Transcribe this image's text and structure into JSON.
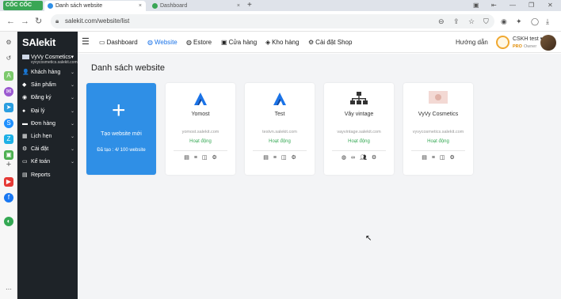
{
  "browser": {
    "brand": "CỐC CỐC",
    "tabs": [
      {
        "label": "Danh sách website",
        "close": "×"
      },
      {
        "label": "Dashboard",
        "close": "×"
      }
    ],
    "new_tab": "+",
    "url": "salekit.com/website/list"
  },
  "app": {
    "logo": "SAlekit",
    "store_name": "VyVy Cosmetics",
    "store_domain": "vyvycosmetics.salekit.com",
    "menu": [
      {
        "label": "Khách hàng",
        "icon": "user-icon",
        "glyph": "👤",
        "has_children": true
      },
      {
        "label": "Sản phẩm",
        "icon": "tag-icon",
        "glyph": "◆",
        "has_children": true
      },
      {
        "label": "Đăng ký",
        "icon": "eye-icon",
        "glyph": "◉",
        "has_children": true
      },
      {
        "label": "Đại lý",
        "icon": "agent-icon",
        "glyph": "●",
        "has_children": true
      },
      {
        "label": "Đơn hàng",
        "icon": "order-icon",
        "glyph": "▬",
        "has_children": true
      },
      {
        "label": "Lịch hẹn",
        "icon": "calendar-icon",
        "glyph": "▦",
        "has_children": true
      },
      {
        "label": "Cài đặt",
        "icon": "settings-icon",
        "glyph": "⚙",
        "has_children": true
      },
      {
        "label": "Kế toán",
        "icon": "accounting-icon",
        "glyph": "▭",
        "has_children": true
      },
      {
        "label": "Reports",
        "icon": "reports-icon",
        "glyph": "▤",
        "has_children": false
      }
    ]
  },
  "topnav": {
    "links": [
      {
        "label": "Dashboard",
        "icon": "monitor-icon",
        "glyph": "▭",
        "active": false
      },
      {
        "label": "Website",
        "icon": "globe-icon",
        "glyph": "◍",
        "active": true
      },
      {
        "label": "Estore",
        "icon": "globe-icon",
        "glyph": "◍",
        "active": false
      },
      {
        "label": "Cửa hàng",
        "icon": "store-icon",
        "glyph": "▣",
        "active": false
      },
      {
        "label": "Kho hàng",
        "icon": "box-icon",
        "glyph": "◈",
        "active": false
      },
      {
        "label": "Cài đặt Shop",
        "icon": "gear-icon",
        "glyph": "⚙",
        "active": false
      }
    ],
    "help": "Hướng dẫn",
    "user_name": "CSKH test",
    "user_badge": "PRO",
    "user_role": "Owner"
  },
  "page": {
    "title": "Danh sách website",
    "create_label": "Tạo website mới",
    "quota": "Đã tạo : 4/ 100 website",
    "sites": [
      {
        "name": "Yomost",
        "domain": "yomost.salekit.com",
        "status": "Hoạt động",
        "logo": "A-logo",
        "actions": [
          "layout-icon",
          "list-icon",
          "columns-icon",
          "gear-icon"
        ]
      },
      {
        "name": "Test",
        "domain": "testvn.salekit.com",
        "status": "Hoạt động",
        "logo": "A-logo",
        "actions": [
          "layout-icon",
          "list-icon",
          "columns-icon",
          "gear-icon"
        ]
      },
      {
        "name": "Vây vintage",
        "domain": "vayvintage.salekit.com",
        "status": "Hoạt động",
        "logo": "sitemap-logo",
        "actions": [
          "globe-icon",
          "link-icon",
          "users-icon",
          "gear-icon"
        ]
      },
      {
        "name": "VyVy Cosmetics",
        "domain": "vyvycosmetics.salekit.com",
        "status": "Hoạt động",
        "logo": "image-logo",
        "actions": [
          "layout-icon",
          "list-icon",
          "columns-icon",
          "gear-icon"
        ]
      }
    ]
  },
  "colors": {
    "accent": "#2f8fe6",
    "active_link": "#1a73e8",
    "status_green": "#34a853",
    "sidebar_bg": "#1e2328"
  }
}
